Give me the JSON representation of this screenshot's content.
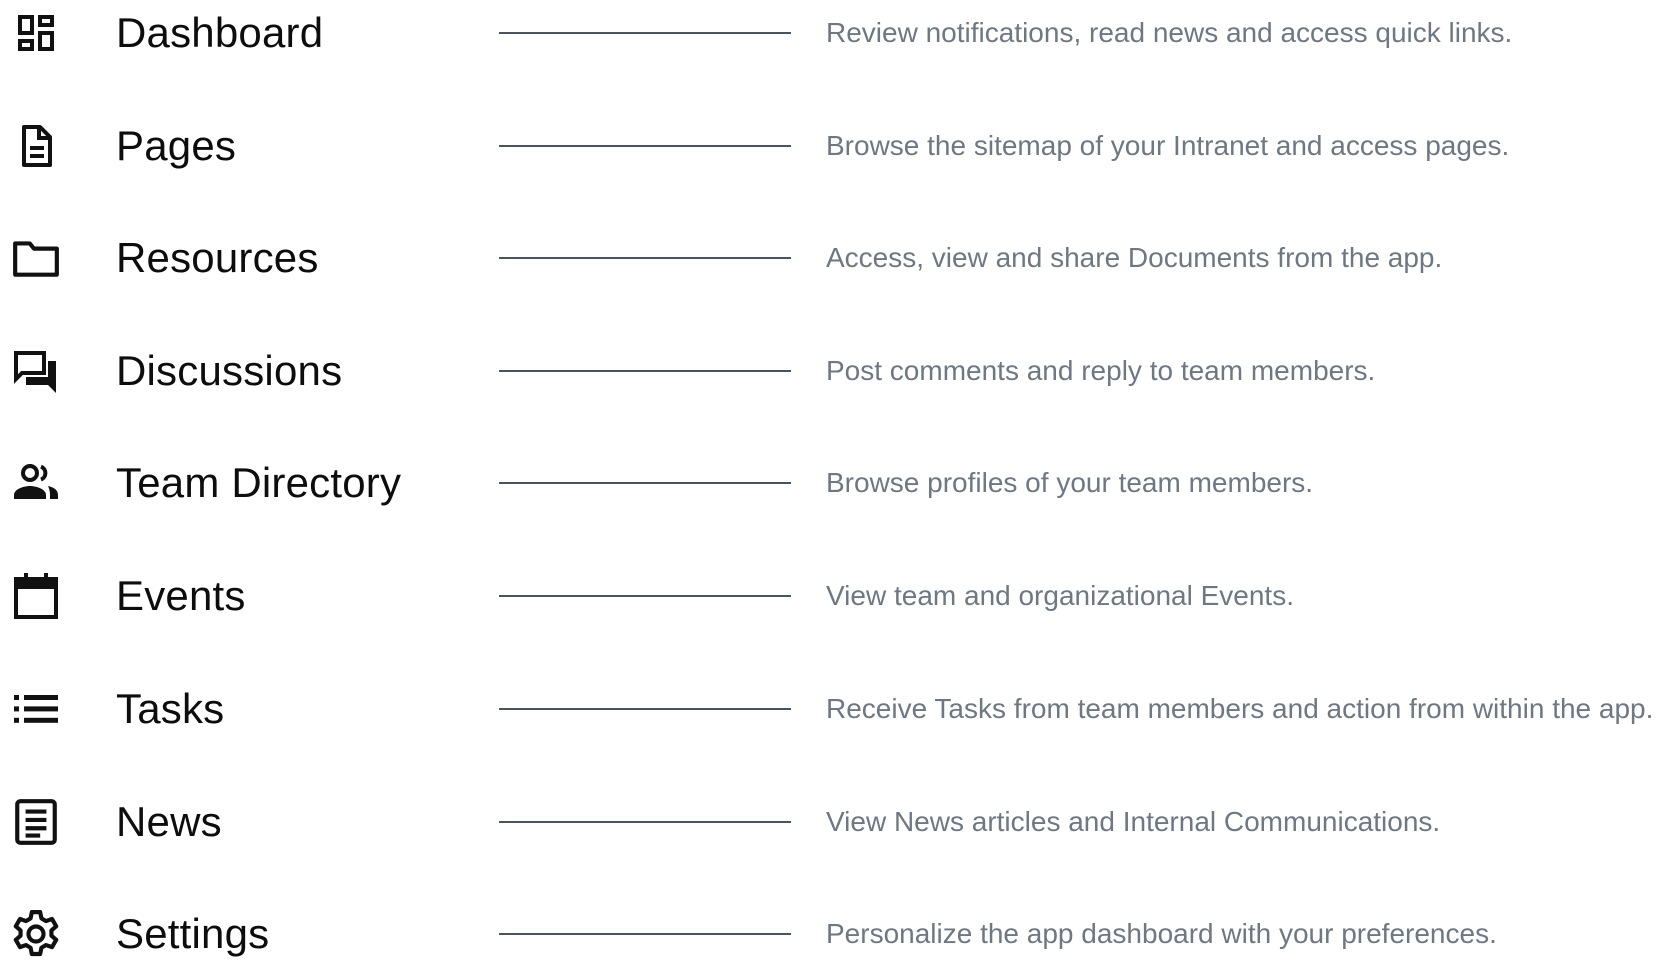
{
  "colors": {
    "icon": "#111111",
    "label": "#0d0d0d",
    "connector": "#4a5360",
    "description": "#6f7782",
    "background": "#ffffff"
  },
  "features": [
    {
      "icon": "dashboard-icon",
      "label": "Dashboard",
      "description": "Review notifications, read news and access quick links."
    },
    {
      "icon": "page-icon",
      "label": "Pages",
      "description": "Browse the sitemap of your Intranet and access pages."
    },
    {
      "icon": "folder-icon",
      "label": "Resources",
      "description": "Access, view and share Documents from the app."
    },
    {
      "icon": "chat-icon",
      "label": "Discussions",
      "description": "Post comments and reply to team members."
    },
    {
      "icon": "people-icon",
      "label": "Team Directory",
      "description": "Browse profiles of your team members."
    },
    {
      "icon": "calendar-icon",
      "label": "Events",
      "description": "View team and organizational Events."
    },
    {
      "icon": "list-icon",
      "label": "Tasks",
      "description": "Receive Tasks from team members and action from within the app."
    },
    {
      "icon": "news-icon",
      "label": "News",
      "description": "View News articles and Internal Communications."
    },
    {
      "icon": "gear-icon",
      "label": "Settings",
      "description": "Personalize the app dashboard with your preferences."
    }
  ]
}
